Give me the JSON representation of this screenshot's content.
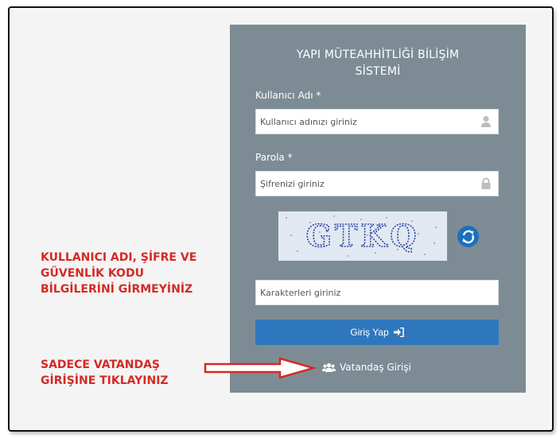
{
  "login": {
    "title_line1": "YAPI MÜTEAHHİTLİĞİ BİLİŞİM",
    "title_line2": "SİSTEMİ",
    "username_label": "Kullanıcı Adı *",
    "username_placeholder": "Kullanıcı adınızı giriniz",
    "password_label": "Parola *",
    "password_placeholder": "Şifrenizi giriniz",
    "captcha_text": "GTKQ",
    "captcha_placeholder": "Karakterleri giriniz",
    "submit_label": "Giriş Yap",
    "citizen_login_label": "Vatandaş Girişi",
    "icons": {
      "username": "user-icon",
      "password": "lock-icon",
      "refresh": "refresh-icon",
      "submit": "sign-in-icon",
      "citizen": "users-icon"
    }
  },
  "annotations": {
    "warning_lines": [
      "KULLANICI ADI, ŞİFRE VE",
      "GÜVENLİK KODU",
      "BİLGİLERİNİ GİRMEYİNİZ"
    ],
    "instruction_lines": [
      "SADECE VATANDAŞ",
      "GİRİŞİNE TIKLAYINIZ"
    ]
  },
  "colors": {
    "panel": "#7d8c94",
    "button": "#2f77bd",
    "annotation": "#d42a25"
  }
}
